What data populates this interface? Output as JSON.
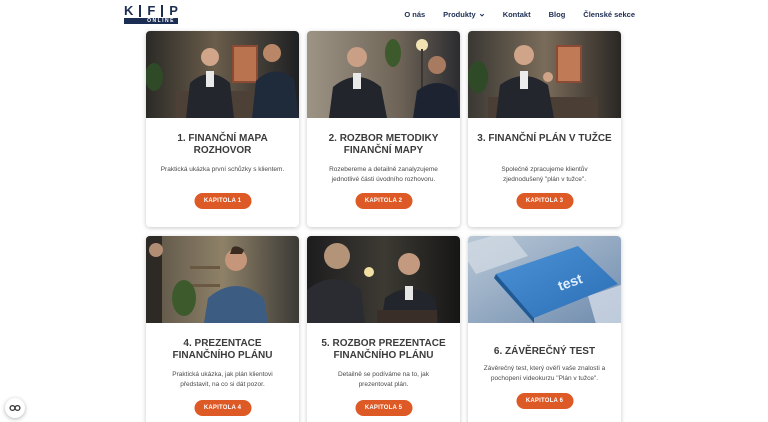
{
  "header": {
    "logo": {
      "letters": [
        "K",
        "F",
        "P"
      ],
      "subtitle": "ONLINE"
    },
    "nav": [
      {
        "label": "O nás"
      },
      {
        "label": "Produkty",
        "has_dropdown": true
      },
      {
        "label": "Kontakt"
      },
      {
        "label": "Blog"
      },
      {
        "label": "Členské sekce"
      }
    ]
  },
  "cards": [
    {
      "title": "1. FINANČNÍ MAPA ROZHOVOR",
      "description": "Praktická ukázka první schůzky s klientem.",
      "button": "KAPITOLA 1",
      "image": "two-men-interview"
    },
    {
      "title": "2. ROZBOR METODIKY FINANČNÍ MAPY",
      "description": "Rozebereme a detailně zanalyzujeme jednotlivé části úvodního rozhovoru.",
      "button": "KAPITOLA 2",
      "image": "two-men-talking"
    },
    {
      "title": "3. FINANČNÍ PLÁN V TUŽCE",
      "description": "Společně zpracujeme klientův zjednodušený \"plán v tužce\".",
      "button": "KAPITOLA 3",
      "image": "man-gesturing"
    },
    {
      "title": "4. PREZENTACE FINANČNÍHO PLÁNU",
      "description": "Praktická ukázka, jak plán klientovi představit, na co si dát pozor.",
      "button": "KAPITOLA 4",
      "image": "young-man-blue-shirt"
    },
    {
      "title": "5. ROZBOR PREZENTACE FINANČNÍHO PLÁNU",
      "description": "Detailně se podíváme na to, jak prezentovat plán.",
      "button": "KAPITOLA 5",
      "image": "two-men-night"
    },
    {
      "title": "6. ZÁVĚREČNÝ TEST",
      "description": "Závěrečný test, který ověří vaše znalosti a pochopení videokurzu \"Plán v tužce\".",
      "button": "KAPITOLA 6",
      "image": "keyboard-test-key",
      "image_text": "test"
    }
  ],
  "colors": {
    "accent": "#dd5a26",
    "brand": "#1c2d53"
  },
  "cookie_icon": "cookie-settings-icon"
}
